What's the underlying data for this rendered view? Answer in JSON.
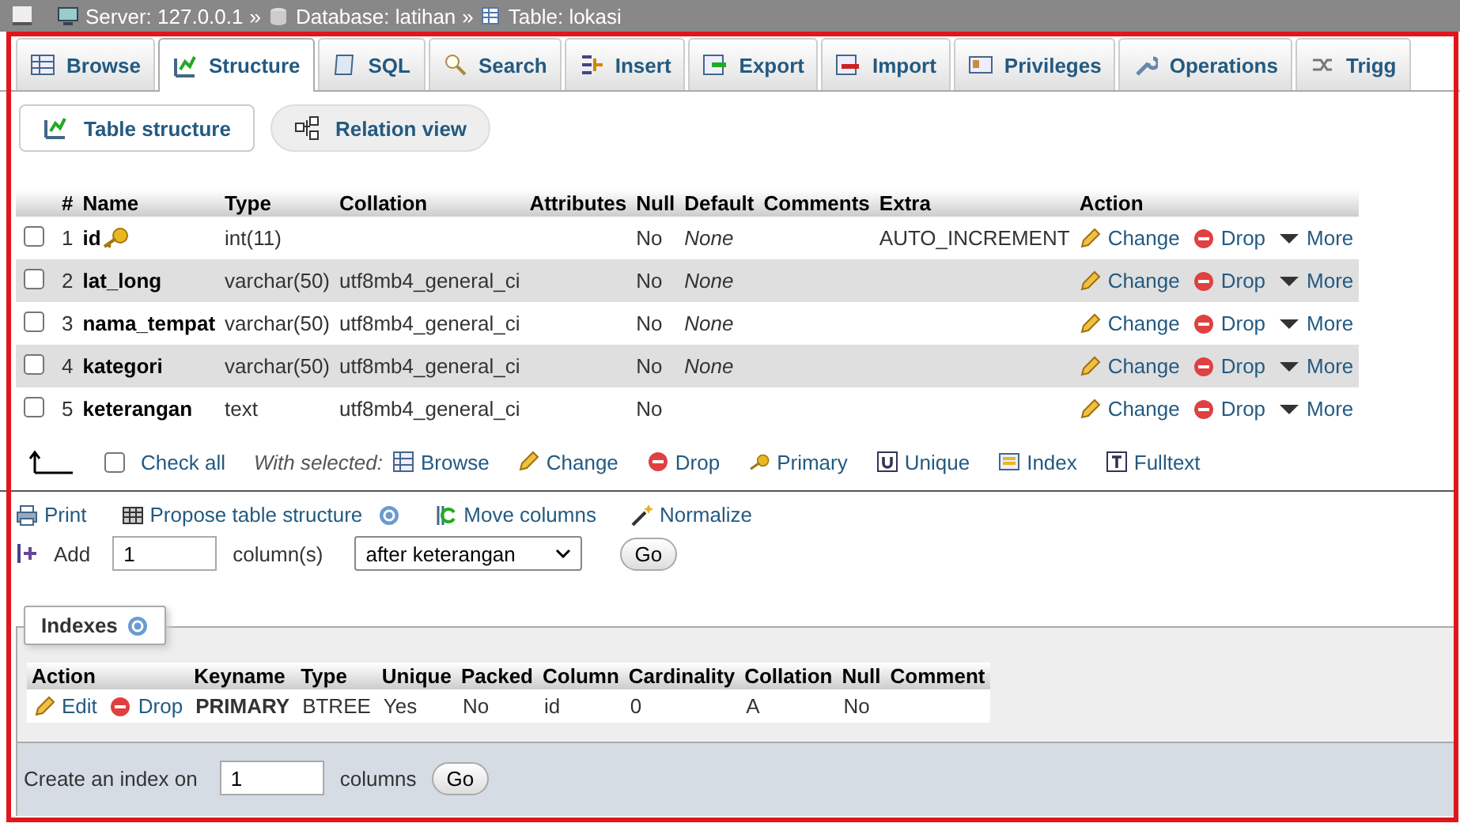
{
  "breadcrumb": {
    "separator": "»",
    "items": [
      {
        "kind": "server",
        "label": "Server: 127.0.0.1"
      },
      {
        "kind": "database",
        "label": "Database: latihan"
      },
      {
        "kind": "table",
        "label": "Table: lokasi"
      }
    ]
  },
  "tabs": [
    {
      "kind": "browse",
      "label": "Browse",
      "selected": false
    },
    {
      "kind": "structure",
      "label": "Structure",
      "selected": true
    },
    {
      "kind": "sql",
      "label": "SQL",
      "selected": false
    },
    {
      "kind": "search",
      "label": "Search",
      "selected": false
    },
    {
      "kind": "insert",
      "label": "Insert",
      "selected": false
    },
    {
      "kind": "export",
      "label": "Export",
      "selected": false
    },
    {
      "kind": "import",
      "label": "Import",
      "selected": false
    },
    {
      "kind": "privileges",
      "label": "Privileges",
      "selected": false
    },
    {
      "kind": "operations",
      "label": "Operations",
      "selected": false
    },
    {
      "kind": "triggers",
      "label": "Trigg",
      "selected": false
    }
  ],
  "subtabs": [
    {
      "kind": "structure",
      "label": "Table structure",
      "selected": true
    },
    {
      "kind": "relation",
      "label": "Relation view",
      "selected": false
    }
  ],
  "structure": {
    "columns": [
      "#",
      "Name",
      "Type",
      "Collation",
      "Attributes",
      "Null",
      "Default",
      "Comments",
      "Extra",
      "Action"
    ],
    "rows": [
      {
        "num": "1",
        "name": "id",
        "key": true,
        "type": "int(11)",
        "null": "No",
        "default": "None",
        "extra": "AUTO_INCREMENT",
        "checked": false,
        "actions": [
          {
            "kind": "change",
            "label": "Change"
          },
          {
            "kind": "drop",
            "label": "Drop"
          },
          {
            "kind": "more",
            "label": "More"
          }
        ]
      },
      {
        "num": "2",
        "name": "lat_long",
        "key": false,
        "type": "varchar(50)",
        "collation": "utf8mb4_general_ci",
        "null": "No",
        "default": "None",
        "checked": false,
        "actions": [
          {
            "kind": "change",
            "label": "Change"
          },
          {
            "kind": "drop",
            "label": "Drop"
          },
          {
            "kind": "more",
            "label": "More"
          }
        ]
      },
      {
        "num": "3",
        "name": "nama_tempat",
        "key": false,
        "type": "varchar(50)",
        "collation": "utf8mb4_general_ci",
        "null": "No",
        "default": "None",
        "checked": false,
        "actions": [
          {
            "kind": "change",
            "label": "Change"
          },
          {
            "kind": "drop",
            "label": "Drop"
          },
          {
            "kind": "more",
            "label": "More"
          }
        ]
      },
      {
        "num": "4",
        "name": "kategori",
        "key": false,
        "type": "varchar(50)",
        "collation": "utf8mb4_general_ci",
        "null": "No",
        "default": "None",
        "checked": false,
        "actions": [
          {
            "kind": "change",
            "label": "Change"
          },
          {
            "kind": "drop",
            "label": "Drop"
          },
          {
            "kind": "more",
            "label": "More"
          }
        ]
      },
      {
        "num": "5",
        "name": "keterangan",
        "key": false,
        "type": "text",
        "collation": "utf8mb4_general_ci",
        "null": "No",
        "checked": false,
        "actions": [
          {
            "kind": "change",
            "label": "Change"
          },
          {
            "kind": "drop",
            "label": "Drop"
          },
          {
            "kind": "more",
            "label": "More"
          }
        ]
      }
    ]
  },
  "bulk": {
    "check_all": {
      "label": "Check all",
      "checked": false
    },
    "with_selected": "With selected:",
    "actions": [
      {
        "kind": "browse",
        "label": "Browse"
      },
      {
        "kind": "change",
        "label": "Change"
      },
      {
        "kind": "drop",
        "label": "Drop"
      },
      {
        "kind": "primary",
        "label": "Primary"
      },
      {
        "kind": "unique",
        "label": "Unique"
      },
      {
        "kind": "index",
        "label": "Index"
      },
      {
        "kind": "fulltext",
        "label": "Fulltext"
      }
    ]
  },
  "tools": [
    {
      "kind": "print",
      "label": "Print"
    },
    {
      "kind": "propose",
      "label": "Propose table structure",
      "help": true
    },
    {
      "kind": "move",
      "label": "Move columns",
      "help": false
    },
    {
      "kind": "normalize",
      "label": "Normalize",
      "help": false
    }
  ],
  "add_columns": {
    "label": "Add",
    "value": "1",
    "unit": "column(s)",
    "position": "after keterangan",
    "button": "Go"
  },
  "indexes": {
    "legend": "Indexes",
    "columns": [
      "Action",
      "Keyname",
      "Type",
      "Unique",
      "Packed",
      "Column",
      "Cardinality",
      "Collation",
      "Null",
      "Comment"
    ],
    "rows": [
      {
        "actions": [
          {
            "kind": "change",
            "label": "Edit"
          },
          {
            "kind": "drop",
            "label": "Drop"
          }
        ],
        "keyname": "PRIMARY",
        "type": "BTREE",
        "unique": "Yes",
        "packed": "No",
        "column": "id",
        "cardinality": "0",
        "collation": "A",
        "null": "No"
      }
    ]
  },
  "create_index": {
    "label": "Create an index on",
    "value": "1",
    "unit": "columns",
    "button": "Go"
  }
}
